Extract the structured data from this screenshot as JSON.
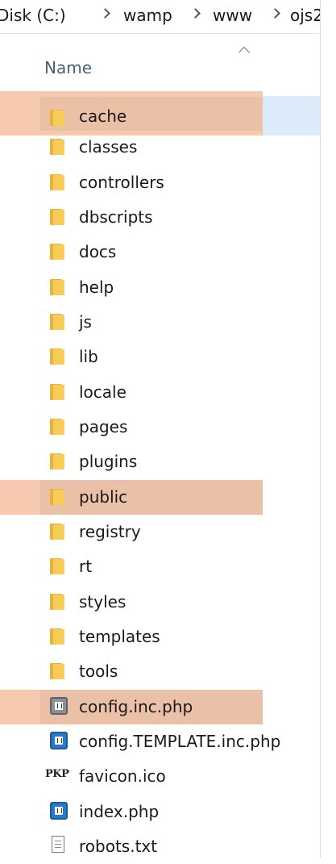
{
  "breadcrumb": [
    {
      "label": "Disk (C:)"
    },
    {
      "label": "wamp"
    },
    {
      "label": "www"
    },
    {
      "label": "ojs2"
    }
  ],
  "column_header": {
    "name_label": "Name",
    "sort": "ascending"
  },
  "files": [
    {
      "name": "cache",
      "type": "folder",
      "highlighted": true,
      "selected": true
    },
    {
      "name": "classes",
      "type": "folder"
    },
    {
      "name": "controllers",
      "type": "folder"
    },
    {
      "name": "dbscripts",
      "type": "folder"
    },
    {
      "name": "docs",
      "type": "folder"
    },
    {
      "name": "help",
      "type": "folder"
    },
    {
      "name": "js",
      "type": "folder"
    },
    {
      "name": "lib",
      "type": "folder"
    },
    {
      "name": "locale",
      "type": "folder"
    },
    {
      "name": "pages",
      "type": "folder"
    },
    {
      "name": "plugins",
      "type": "folder"
    },
    {
      "name": "public",
      "type": "folder",
      "highlighted": true
    },
    {
      "name": "registry",
      "type": "folder"
    },
    {
      "name": "rt",
      "type": "folder"
    },
    {
      "name": "styles",
      "type": "folder"
    },
    {
      "name": "templates",
      "type": "folder"
    },
    {
      "name": "tools",
      "type": "folder"
    },
    {
      "name": "config.inc.php",
      "type": "php-file",
      "highlighted": true
    },
    {
      "name": "config.TEMPLATE.inc.php",
      "type": "php-file"
    },
    {
      "name": "favicon.ico",
      "type": "pkp-icon-file",
      "icon_text": "PKP"
    },
    {
      "name": "index.php",
      "type": "php-file"
    },
    {
      "name": "robots.txt",
      "type": "text-file"
    }
  ],
  "colors": {
    "highlight": "#f7c9ae",
    "selection": "#dbebf9",
    "folder": "#f7cc58",
    "php_blue": "#2a78c8",
    "header_text": "#4c607a"
  }
}
